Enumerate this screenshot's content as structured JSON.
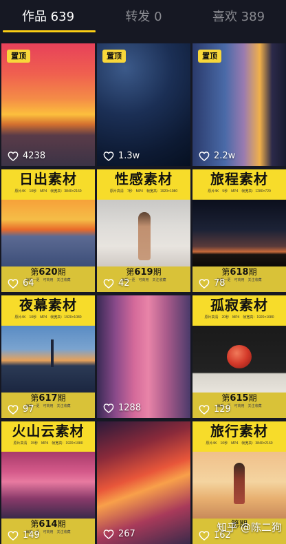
{
  "tabs": [
    {
      "label": "作品 639"
    },
    {
      "label": "转发 0"
    },
    {
      "label": "喜欢 389"
    }
  ],
  "pin_label": "置顶",
  "grid": {
    "cells": [
      {
        "likes": "4238",
        "pinned": true
      },
      {
        "likes": "1.3w",
        "pinned": true
      },
      {
        "likes": "2.2w",
        "pinned": true
      },
      {
        "likes": "64",
        "title": "日出素材",
        "specs": "原片4K　10秒　MP4　帧宽高：3840×2160",
        "episode_prefix": "第",
        "episode_num": "620",
        "episode_suffix": "期",
        "episode_sub": "每期一更　可商用　关注收藏"
      },
      {
        "likes": "42",
        "title": "性感素材",
        "specs": "原片高清　7秒　MP4　帧宽高：1920×1080",
        "episode_prefix": "第",
        "episode_num": "619",
        "episode_suffix": "期",
        "episode_sub": "每期一更　可商用　关注收藏"
      },
      {
        "likes": "78",
        "title": "旅程素材",
        "specs": "原片4K　5秒　MP4　帧宽高：1280×720",
        "episode_prefix": "第",
        "episode_num": "618",
        "episode_suffix": "期",
        "episode_sub": "每期一更　可商用　关注收藏"
      },
      {
        "likes": "97",
        "title": "夜幕素材",
        "specs": "原片4K　10秒　MP4　帧宽高：1920×1080",
        "episode_prefix": "第",
        "episode_num": "617",
        "episode_suffix": "期",
        "episode_sub": "每期一更　可商用　关注收藏"
      },
      {
        "likes": "1288"
      },
      {
        "likes": "129",
        "title": "孤寂素材",
        "specs": "原片高清　20秒　MP4　帧宽高：1920×1080",
        "episode_prefix": "第",
        "episode_num": "615",
        "episode_suffix": "期",
        "episode_sub": "每期一更　可商用　关注收藏"
      },
      {
        "likes": "149",
        "title": "火山云素材",
        "specs": "原片高清　15秒　MP4　帧宽高：1920×1080",
        "episode_prefix": "第",
        "episode_num": "614",
        "episode_suffix": "期",
        "episode_sub": "每期一更　可商用　关注收藏"
      },
      {
        "likes": "267"
      },
      {
        "likes": "162",
        "title": "旅行素材",
        "specs": "原片4K　10秒　MP4　帧宽高：3840×2160",
        "episode_prefix": "第",
        "episode_num": "",
        "episode_suffix": "期",
        "episode_sub": ""
      }
    ]
  },
  "watermark": "知乎 @陈二狗",
  "colors": {
    "accent": "#face15",
    "banner": "#f7dc2a",
    "background": "#161823"
  }
}
